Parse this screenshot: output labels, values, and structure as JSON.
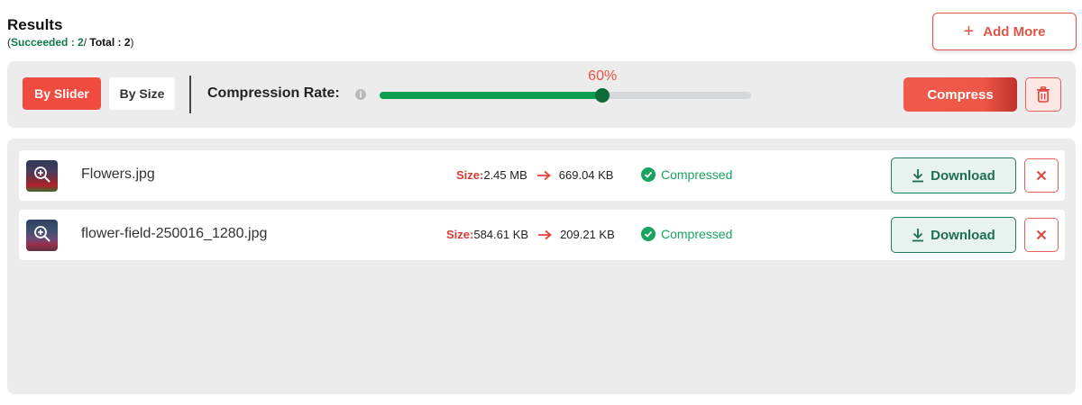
{
  "header": {
    "title": "Results",
    "open_paren": "(",
    "succeeded_label": "Succeeded : 2",
    "separator": "/",
    "total_label": "Total : 2",
    "close_paren": ")"
  },
  "add_more": {
    "label": "Add More"
  },
  "toolbar": {
    "by_slider_label": "By Slider",
    "by_size_label": "By Size",
    "rate_label": "Compression Rate:",
    "rate_value": 60,
    "rate_display": "60%",
    "compress_label": "Compress"
  },
  "files": [
    {
      "name": "Flowers.jpg",
      "size_label": "Size:",
      "original_size": "2.45 MB",
      "compressed_size": "669.04 KB",
      "status": "Compressed",
      "download_label": "Download"
    },
    {
      "name": "flower-field-250016_1280.jpg",
      "size_label": "Size:",
      "original_size": "584.61 KB",
      "compressed_size": "209.21 KB",
      "status": "Compressed",
      "download_label": "Download"
    }
  ],
  "colors": {
    "accent_red": "#ef4b3f",
    "success_green": "#18a35f",
    "slider_green": "#0c9d50",
    "download_green": "#1e6e50"
  },
  "icons": {
    "add": "plus-icon",
    "info": "info-icon",
    "delete": "trash-icon",
    "zoom": "zoom-in-icon",
    "arrow": "arrow-right-icon",
    "status": "check-circle-icon",
    "download": "download-icon",
    "remove": "close-icon"
  }
}
